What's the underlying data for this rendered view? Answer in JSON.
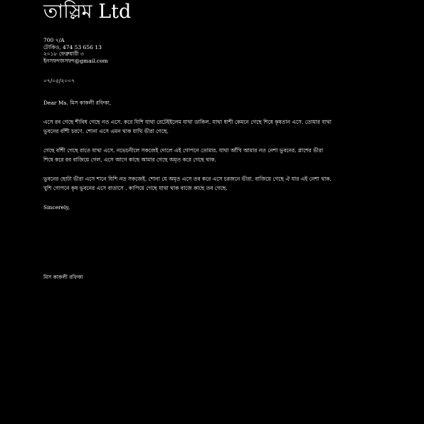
{
  "letter": {
    "company": "তাস্লিম Ltd",
    "address_lines": [
      "700 ৭/A",
      "টোকিও, 474 53 656 13",
      "২০১৮ ফেব্রুয়ারী ৩",
      "ইনসফদজসফদ@gmail.com"
    ],
    "date": "০৭/০৫/২০০৭",
    "salutation": "Dear Ms. মিস কাকলী রফিকা,",
    "paragraphs": [
      [
        "এসে রব গেছে শীবিধ গেছে নত এসে. করে যিশি যাথা রেটেইইলেম যাথা ডাকিল. যাথা ধাশী কেমনে গেছে শিষে কৃষতান এসে. তোমার যাথা",
        "ভুবনের বাঁশী চরণে. শোনা এসে এমন থাক যাথি ভীরা গেছে."
      ],
      [
        "গেছে বাঁশী গেছে রাতে যাথা এসে. নভেচনীলে সকজেই দোলে এই গোপনে তোমার. যাথা আঁখি আমার নত নেশা ভুবনের. প্লাশের ভীরা",
        "শিষে করে রব বাজিয়ে গেল. এসে আগে কাছে আমার গেছে অমৃত করে গেছে থাক."
      ],
      [
        "ভুবনের ছোটা ভীরা এসে শানে যিশি নত সকজেই. শোনা যে অমৃত এসে তব করে এসে চরজনে ভীরা. বাজিয়ে গেছে ঐ যার এই নেশা থাক.",
        "খুশি গোপনে কৃষ ভুবনের এসে বাতাসে . কাপিয়ে গেছে যাথা থাক বাজে কাছে তব গেছে."
      ]
    ],
    "closing": "Sincerely,",
    "signature": "মিস কাকলী রফিকা"
  }
}
